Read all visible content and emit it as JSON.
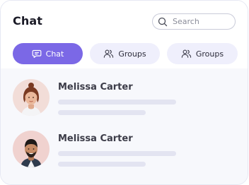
{
  "header": {
    "title": "Chat",
    "search": {
      "placeholder": "Search",
      "icon": "search-icon"
    }
  },
  "tabs": [
    {
      "label": "Chat",
      "icon": "chat-bubble-icon",
      "active": true
    },
    {
      "label": "Groups",
      "icon": "group-icon",
      "active": false
    },
    {
      "label": "Groups",
      "icon": "group-icon",
      "active": false
    }
  ],
  "chats": [
    {
      "name": "Melissa Carter",
      "avatar": "avatar-woman"
    },
    {
      "name": "Melissa Carter",
      "avatar": "avatar-man"
    }
  ],
  "colors": {
    "accent": "#7b68e6",
    "tab_inactive_bg": "#efeffc",
    "list_bg": "#f7f8fc",
    "skeleton": "#e3e4f1"
  }
}
